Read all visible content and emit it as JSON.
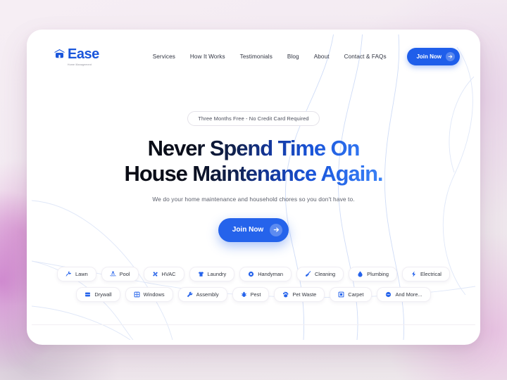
{
  "brand": {
    "name": "Ease",
    "tagline": "Home Management",
    "logo_icon": "house-icon",
    "accent_color": "#1a56db"
  },
  "header": {
    "nav": [
      {
        "label": "Services",
        "name": "nav-services"
      },
      {
        "label": "How It Works",
        "name": "nav-how-it-works"
      },
      {
        "label": "Testimonials",
        "name": "nav-testimonials"
      },
      {
        "label": "Blog",
        "name": "nav-blog"
      },
      {
        "label": "About",
        "name": "nav-about"
      },
      {
        "label": "Contact & FAQs",
        "name": "nav-contact-faqs"
      }
    ],
    "cta": {
      "label": "Join Now",
      "icon": "arrow-right-icon",
      "bg_color": "#1f5eea"
    }
  },
  "hero": {
    "badge": "Three Months Free - No Credit Card Required",
    "headline_line1": "Never Spend Time On",
    "headline_line2": "House Maintenance Again.",
    "subtitle": "We do your home maintenance and household chores so you don't have to.",
    "cta": {
      "label": "Join Now",
      "icon": "arrow-right-icon",
      "bg_color": "#2563eb"
    },
    "headline_gradient_from": "#0a0c14",
    "headline_gradient_to": "#3d84f5"
  },
  "services": {
    "row1": [
      {
        "label": "Lawn",
        "icon": "grass-icon"
      },
      {
        "label": "Pool",
        "icon": "pool-icon"
      },
      {
        "label": "HVAC",
        "icon": "fan-icon"
      },
      {
        "label": "Laundry",
        "icon": "shirt-icon"
      },
      {
        "label": "Handyman",
        "icon": "gear-icon"
      },
      {
        "label": "Cleaning",
        "icon": "broom-icon"
      },
      {
        "label": "Plumbing",
        "icon": "droplet-icon"
      },
      {
        "label": "Electrical",
        "icon": "bolt-icon"
      }
    ],
    "row2": [
      {
        "label": "Drywall",
        "icon": "wall-icon"
      },
      {
        "label": "Windows",
        "icon": "window-icon"
      },
      {
        "label": "Assembly",
        "icon": "wrench-icon"
      },
      {
        "label": "Pest",
        "icon": "bug-icon"
      },
      {
        "label": "Pet Waste",
        "icon": "paw-icon"
      },
      {
        "label": "Carpet",
        "icon": "carpet-icon"
      },
      {
        "label": "And More...",
        "icon": "dots-circle-icon"
      }
    ]
  },
  "theme": {
    "page_background": "#f2e9f0",
    "card_background": "#ffffff",
    "chip_border": "#f0eef4",
    "deco_line_color": "#cfdcf7"
  }
}
